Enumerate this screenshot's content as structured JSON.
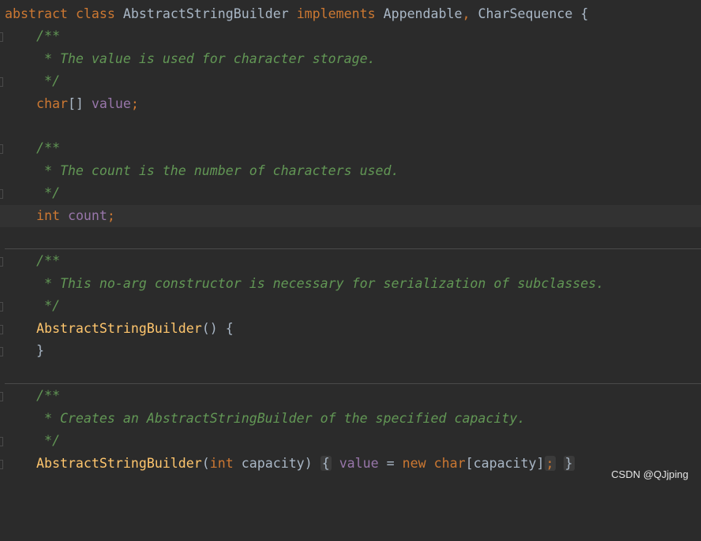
{
  "code": {
    "l1": {
      "kw1": "abstract",
      "kw2": "class",
      "name": "AbstractStringBuilder",
      "kw3": "implements",
      "iface1": "Appendable",
      "comma": ",",
      "iface2": "CharSequence",
      "brace": "{"
    },
    "l2": "/**",
    "l3": " * The value is used for character storage.",
    "l4": " */",
    "l5": {
      "type": "char",
      "brackets": "[]",
      "field": "value",
      "semi": ";"
    },
    "l7": "/**",
    "l8": " * The count is the number of characters used.",
    "l9": " */",
    "l10": {
      "type": "int",
      "field": "count",
      "semi": ";"
    },
    "l12": "/**",
    "l13": " * This no-arg constructor is necessary for serialization of subclasses.",
    "l14": " */",
    "l15": {
      "name": "AbstractStringBuilder",
      "parens": "()",
      "brace": "{"
    },
    "l16": "}",
    "l18": "/**",
    "l19": " * Creates an AbstractStringBuilder of the specified capacity.",
    "l20": " */",
    "l21": {
      "name": "AbstractStringBuilder",
      "open": "(",
      "type": "int",
      "param": "capacity",
      "close": ")",
      "lbrace": "{",
      "field": "value",
      "eq": "=",
      "kw": "new",
      "type2": "char",
      "bracket_open": "[",
      "param2": "capacity",
      "bracket_close": "]",
      "semi": ";",
      "rbrace": "}"
    }
  },
  "watermark": "CSDN @QJjping",
  "colors": {
    "background": "#2b2b2b",
    "keyword": "#cc7832",
    "comment": "#629755",
    "method": "#ffc66d",
    "field": "#9876aa",
    "text": "#a9b7c6"
  }
}
